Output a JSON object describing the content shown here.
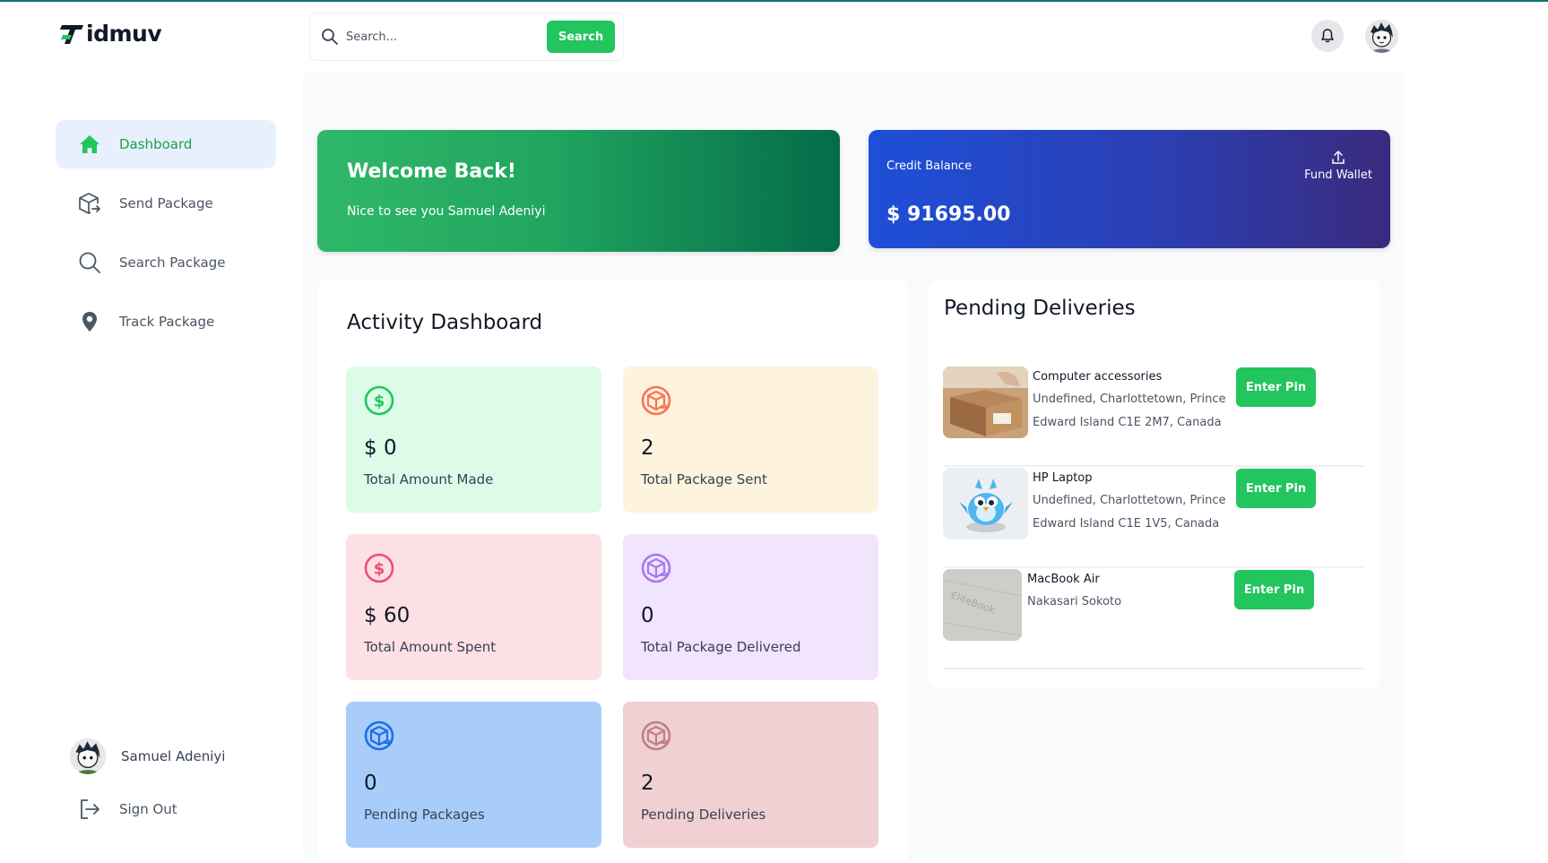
{
  "brand": {
    "name": "idmuv"
  },
  "search": {
    "placeholder": "Search...",
    "button_label": "Search"
  },
  "sidebar": {
    "items": [
      {
        "label": "Dashboard",
        "icon": "home-icon",
        "active": true
      },
      {
        "label": "Send Package",
        "icon": "box-send-icon",
        "active": false
      },
      {
        "label": "Search Package",
        "icon": "search-icon",
        "active": false
      },
      {
        "label": "Track Package",
        "icon": "location-pin-icon",
        "active": false
      }
    ],
    "user_name": "Samuel Adeniyi",
    "sign_out_label": "Sign Out"
  },
  "welcome": {
    "title": "Welcome Back!",
    "subtitle": "Nice to see you Samuel Adeniyi"
  },
  "credit": {
    "label": "Credit Balance",
    "amount": "$ 91695.00",
    "fund_label": "Fund Wallet"
  },
  "activity": {
    "title": "Activity Dashboard",
    "cards": [
      {
        "value": "$ 0",
        "caption": "Total Amount Made",
        "bg": "#dcfce7",
        "icon_color": "#22c55e",
        "icon": "dollar-icon"
      },
      {
        "value": "2",
        "caption": "Total Package Sent",
        "bg": "#fef3dc",
        "icon_color": "#f97353",
        "icon": "package-icon"
      },
      {
        "value": "$ 60",
        "caption": "Total Amount Spent",
        "bg": "#fde0e4",
        "icon_color": "#ec4f73",
        "icon": "dollar-icon"
      },
      {
        "value": "0",
        "caption": "Total Package Delivered",
        "bg": "#f1e4fd",
        "icon_color": "#a777f2",
        "icon": "package-icon"
      },
      {
        "value": "0",
        "caption": "Pending Packages",
        "bg": "#a9cdfb",
        "icon_color": "#1d6de8",
        "icon": "package-icon"
      },
      {
        "value": "2",
        "caption": "Pending Deliveries",
        "bg": "#f0d0d2",
        "icon_color": "#c07f82",
        "icon": "package-icon"
      }
    ]
  },
  "pending": {
    "title": "Pending Deliveries",
    "items": [
      {
        "name": "Computer accessories",
        "address_line1": "Undefined, Charlottetown, Prince",
        "address_line2": "Edward Island C1E 2M7, Canada",
        "button": "Enter Pin"
      },
      {
        "name": "HP Laptop",
        "address_line1": "Undefined, Charlottetown, Prince",
        "address_line2": "Edward Island C1E 1V5, Canada",
        "button": "Enter Pin"
      },
      {
        "name": "MacBook Air",
        "address_line1": "Nakasari Sokoto",
        "address_line2": "",
        "button": "Enter Pin"
      }
    ]
  },
  "colors": {
    "accent": "#22c55e",
    "active_nav_bg": "#e8f0fe"
  }
}
